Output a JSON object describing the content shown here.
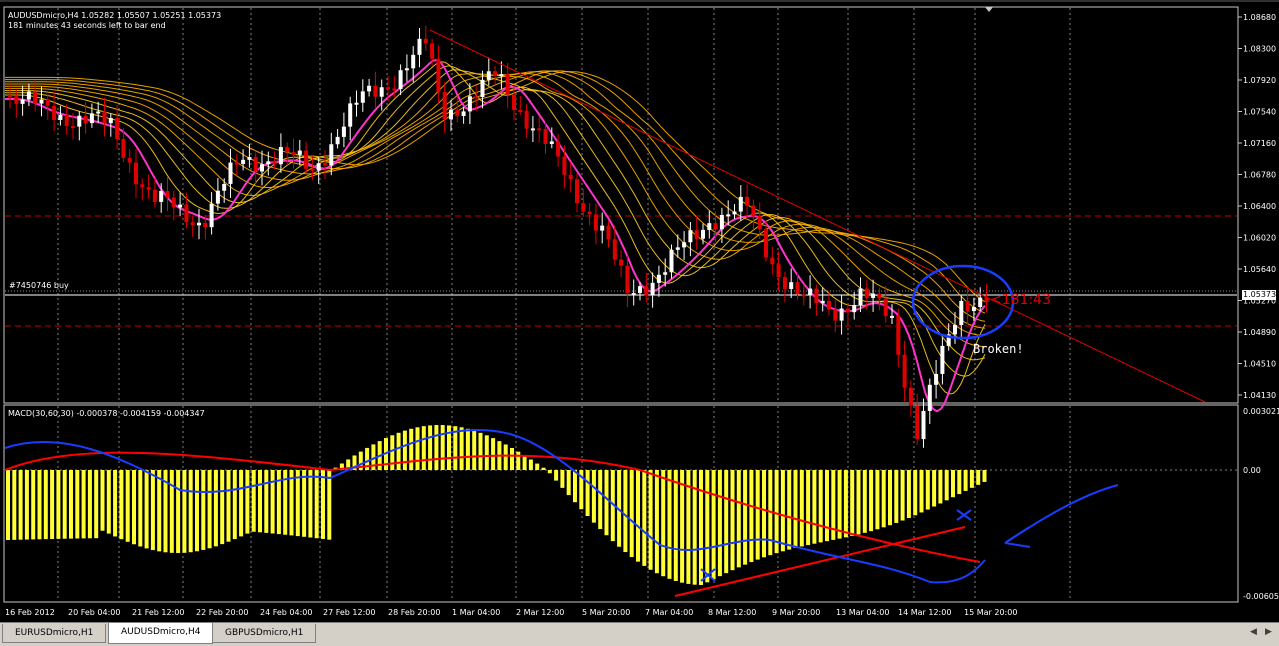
{
  "window": {
    "symbol_info": "AUDUSDmicro,H4  1.05282 1.05507 1.05251 1.05373",
    "timer_info": "181 minutes 43 seconds left to bar end"
  },
  "price_axis": {
    "labels": [
      "1.08680",
      "1.08300",
      "1.07920",
      "1.07540",
      "1.07160",
      "1.06780",
      "1.06400",
      "1.06020",
      "1.05640",
      "1.05270",
      "1.04890",
      "1.04510",
      "1.04130"
    ],
    "current_price": "1.05373",
    "range": [
      1.0413,
      1.0868
    ]
  },
  "order_label": "#7450746 buy",
  "annotations": {
    "countdown": "<181:43",
    "broken": "Broken!"
  },
  "macd": {
    "label": "MACD(30,60,30) -0.000378 -0.004159 -0.004347",
    "axis_labels": [
      "0.003021",
      "0.00",
      "-0.00605"
    ]
  },
  "time_axis": {
    "labels": [
      "16 Feb 2012",
      "20 Feb 04:00",
      "21 Feb 12:00",
      "22 Feb 20:00",
      "24 Feb 04:00",
      "27 Feb 12:00",
      "28 Feb 20:00",
      "1 Mar 04:00",
      "2 Mar 12:00",
      "5 Mar 20:00",
      "7 Mar 04:00",
      "8 Mar 12:00",
      "9 Mar 20:00",
      "13 Mar 04:00",
      "14 Mar 12:00",
      "15 Mar 20:00"
    ]
  },
  "tabs": [
    {
      "label": "EURUSDmicro,H1",
      "active": false
    },
    {
      "label": "AUDUSDmicro,H4",
      "active": true
    },
    {
      "label": "GBPUSDmicro,H1",
      "active": false
    }
  ],
  "colors": {
    "bull": "#ffffff",
    "bear": "#e00000",
    "histogram": "#ffff33",
    "macd_signal": "#ff0000",
    "macd_main": "#1a3cff",
    "ma_fast": "#ff33cc",
    "ma_ribbon": "#ffb000",
    "annotation": "#1a3cff"
  }
}
